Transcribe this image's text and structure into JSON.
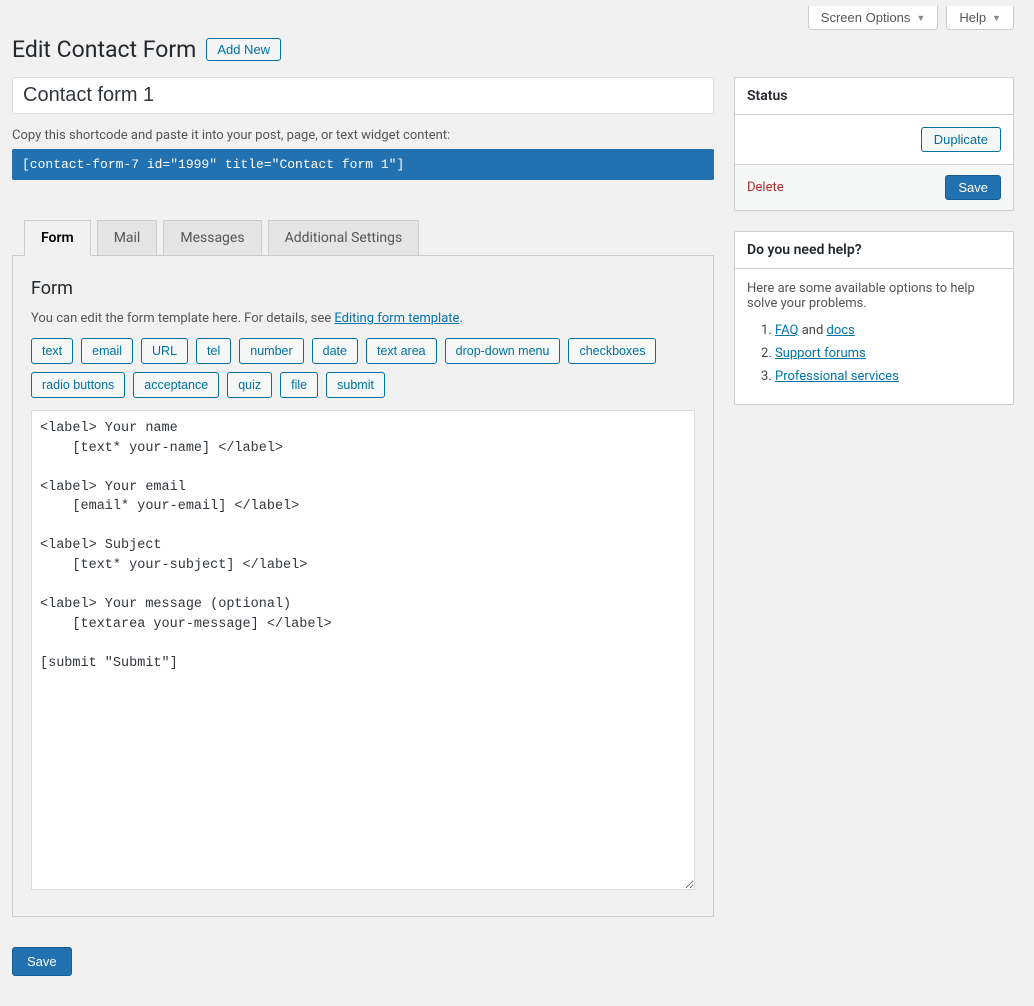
{
  "topButtons": {
    "screenOptions": "Screen Options",
    "help": "Help"
  },
  "header": {
    "title": "Edit Contact Form",
    "addNew": "Add New"
  },
  "form": {
    "titleValue": "Contact form 1",
    "shortcodeLabel": "Copy this shortcode and paste it into your post, page, or text widget content:",
    "shortcode": "[contact-form-7 id=\"1999\" title=\"Contact form 1\"]"
  },
  "tabs": [
    "Form",
    "Mail",
    "Messages",
    "Additional Settings"
  ],
  "panel": {
    "title": "Form",
    "descPrefix": "You can edit the form template here. For details, see ",
    "descLink": "Editing form template",
    "descSuffix": "."
  },
  "tagButtons": [
    "text",
    "email",
    "URL",
    "tel",
    "number",
    "date",
    "text area",
    "drop-down menu",
    "checkboxes",
    "radio buttons",
    "acceptance",
    "quiz",
    "file",
    "submit"
  ],
  "templateContent": "<label> Your name\n    [text* your-name] </label>\n\n<label> Your email\n    [email* your-email] </label>\n\n<label> Subject\n    [text* your-subject] </label>\n\n<label> Your message (optional)\n    [textarea your-message] </label>\n\n[submit \"Submit\"]",
  "saveLabel": "Save",
  "sidebar": {
    "status": {
      "title": "Status",
      "duplicate": "Duplicate",
      "delete": "Delete",
      "save": "Save"
    },
    "help": {
      "title": "Do you need help?",
      "intro": "Here are some available options to help solve your problems.",
      "faqLabel": "FAQ",
      "andLabel": " and ",
      "docsLabel": "docs",
      "forumsLabel": "Support forums",
      "servicesLabel": "Professional services"
    }
  }
}
